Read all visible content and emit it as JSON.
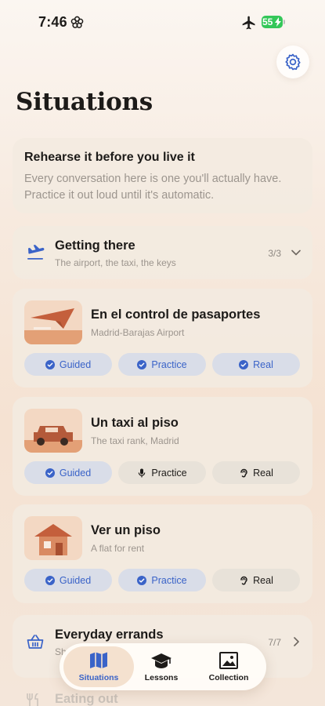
{
  "status_bar": {
    "time": "7:46",
    "battery": "55"
  },
  "title": "Situations",
  "intro": {
    "heading": "Rehearse it before you live it",
    "body": "Every conversation here is one you'll actually have. Practice it out loud until it's automatic."
  },
  "groups": [
    {
      "title": "Getting there",
      "subtitle": "The airport, the taxi, the keys",
      "count": "3/3",
      "icon": "plane-landing-icon",
      "expanded": true
    },
    {
      "title": "Everyday errands",
      "subtitle": "Sh",
      "count": "7/7",
      "icon": "basket-icon",
      "expanded": false
    },
    {
      "title": "Eating out",
      "icon": "utensils-icon"
    }
  ],
  "situations": [
    {
      "title": "En el control de pasaportes",
      "subtitle": "Madrid-Barajas Airport",
      "modes": [
        {
          "label": "Guided",
          "state": "done",
          "icon": "check-circle-icon"
        },
        {
          "label": "Practice",
          "state": "done",
          "icon": "check-circle-icon"
        },
        {
          "label": "Real",
          "state": "done",
          "icon": "check-circle-icon"
        }
      ]
    },
    {
      "title": "Un taxi al piso",
      "subtitle": "The taxi rank, Madrid",
      "modes": [
        {
          "label": "Guided",
          "state": "done",
          "icon": "check-circle-icon"
        },
        {
          "label": "Practice",
          "state": "todo",
          "icon": "microphone-icon"
        },
        {
          "label": "Real",
          "state": "todo",
          "icon": "ear-icon"
        }
      ]
    },
    {
      "title": "Ver un piso",
      "subtitle": "A flat for rent",
      "modes": [
        {
          "label": "Guided",
          "state": "done",
          "icon": "check-circle-icon"
        },
        {
          "label": "Practice",
          "state": "done",
          "icon": "check-circle-icon"
        },
        {
          "label": "Real",
          "state": "todo",
          "icon": "ear-icon"
        }
      ]
    }
  ],
  "tabbar": {
    "tabs": [
      {
        "label": "Situations",
        "icon": "map-icon",
        "active": true
      },
      {
        "label": "Lessons",
        "icon": "graduation-cap-icon",
        "active": false
      },
      {
        "label": "Collection",
        "icon": "image-icon",
        "active": false
      }
    ]
  },
  "colors": {
    "accent": "#3a63c8",
    "done_chip": "#d9dde8",
    "todo_chip": "#e8e2d9",
    "thumb": "#f3d8c3",
    "illustration": "#c76a45"
  }
}
